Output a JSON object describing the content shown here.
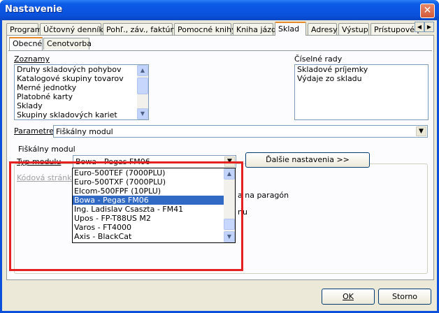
{
  "window": {
    "title": "Nastavenie"
  },
  "tabs": [
    {
      "label": "Program"
    },
    {
      "label": "Účtovný denník"
    },
    {
      "label": "Pohľ., záv., faktúry"
    },
    {
      "label": "Pomocné knihy"
    },
    {
      "label": "Kniha jázd"
    },
    {
      "label": "Sklad"
    },
    {
      "label": "Adresy"
    },
    {
      "label": "Výstup"
    },
    {
      "label": "Prístupové pr"
    }
  ],
  "subtabs": [
    {
      "label": "Obecné"
    },
    {
      "label": "Cenotvorba"
    }
  ],
  "zoznamy": {
    "label": "Zoznamy",
    "items": [
      "Druhy skladových pohybov",
      "Katalogové skupiny tovarov",
      "Merné jednotky",
      "Platobné karty",
      "Sklady",
      "Skupiny skladových kariet"
    ]
  },
  "ciselne_rady": {
    "label": "Číselné rady",
    "items": [
      "Skladové príjemky",
      "Výdaje zo skladu"
    ]
  },
  "parametre": {
    "label": "Parametre",
    "value": "Fiškálny modul"
  },
  "fiskalny": {
    "group_label": "Fiškálny modul",
    "typ_label": "Typ modulu",
    "typ_value": "Bowa - Pegas FM06",
    "kodova_label": "Kódová stránka",
    "dalsie_button": "Ďalšie nastavenia >>",
    "behind_text_1": "a na paragón",
    "behind_text_2": "nu"
  },
  "dropdown_options": [
    "Euro-500TEF (7000PLU)",
    "Euro-500TXF (7000PLU)",
    "Elcom-500FPF (10PLU)",
    "Bowa - Pegas FM06",
    "Ing. Ladislav Csaszta - FM41",
    "Upos - FP-T88US M2",
    "Varos - FT4000",
    "Axis - BlackCat"
  ],
  "dropdown_selected_index": 3,
  "buttons": {
    "ok": "OK",
    "storno": "Storno"
  }
}
